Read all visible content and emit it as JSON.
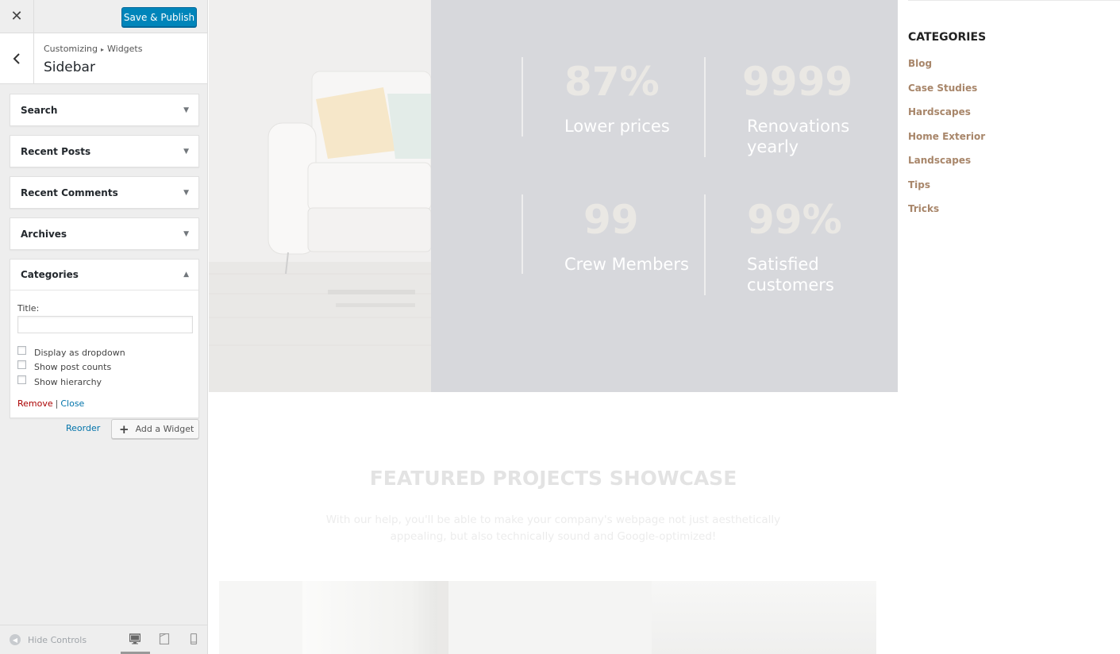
{
  "customizer": {
    "close_icon": "close-icon",
    "save_label": "Save & Publish",
    "breadcrumb": {
      "root": "Customizing",
      "sep": "▸",
      "panel": "Widgets"
    },
    "section_title": "Sidebar",
    "widgets": [
      {
        "title": "Search",
        "open": false
      },
      {
        "title": "Recent Posts",
        "open": false
      },
      {
        "title": "Recent Comments",
        "open": false
      },
      {
        "title": "Archives",
        "open": false
      },
      {
        "title": "Categories",
        "open": true
      }
    ],
    "categories_form": {
      "title_label": "Title:",
      "title_value": "",
      "options": [
        {
          "label": "Display as dropdown",
          "checked": false
        },
        {
          "label": "Show post counts",
          "checked": false
        },
        {
          "label": "Show hierarchy",
          "checked": false
        }
      ],
      "remove_label": "Remove",
      "separator": "|",
      "close_label": "Close"
    },
    "reorder_label": "Reorder",
    "add_widget_label": "Add a Widget",
    "hide_controls_label": "Hide Controls"
  },
  "preview": {
    "stats": [
      {
        "number": "87%",
        "label": "Lower prices"
      },
      {
        "number": "9999",
        "label": "Renovations yearly"
      },
      {
        "number": "99",
        "label": "Crew Members"
      },
      {
        "number": "99%",
        "label": "Satisfied customers"
      }
    ],
    "sidebar_widget": {
      "heading": "CATEGORIES",
      "items": [
        "Blog",
        "Case Studies",
        "Hardscapes",
        "Home Exterior",
        "Landscapes",
        "Tips",
        "Tricks"
      ]
    },
    "featured": {
      "title": "FEATURED PROJECTS SHOWCASE",
      "text": "With our help, you'll be able to make your company's webpage not just aesthetically appealing, but also technically sound and Google-optimized!"
    }
  },
  "colors": {
    "primary_button": "#0085ba",
    "link": "#0073aa",
    "remove_link": "#aa0000",
    "category_link": "#a8866a",
    "stats_panel": "#d7d8dc"
  }
}
